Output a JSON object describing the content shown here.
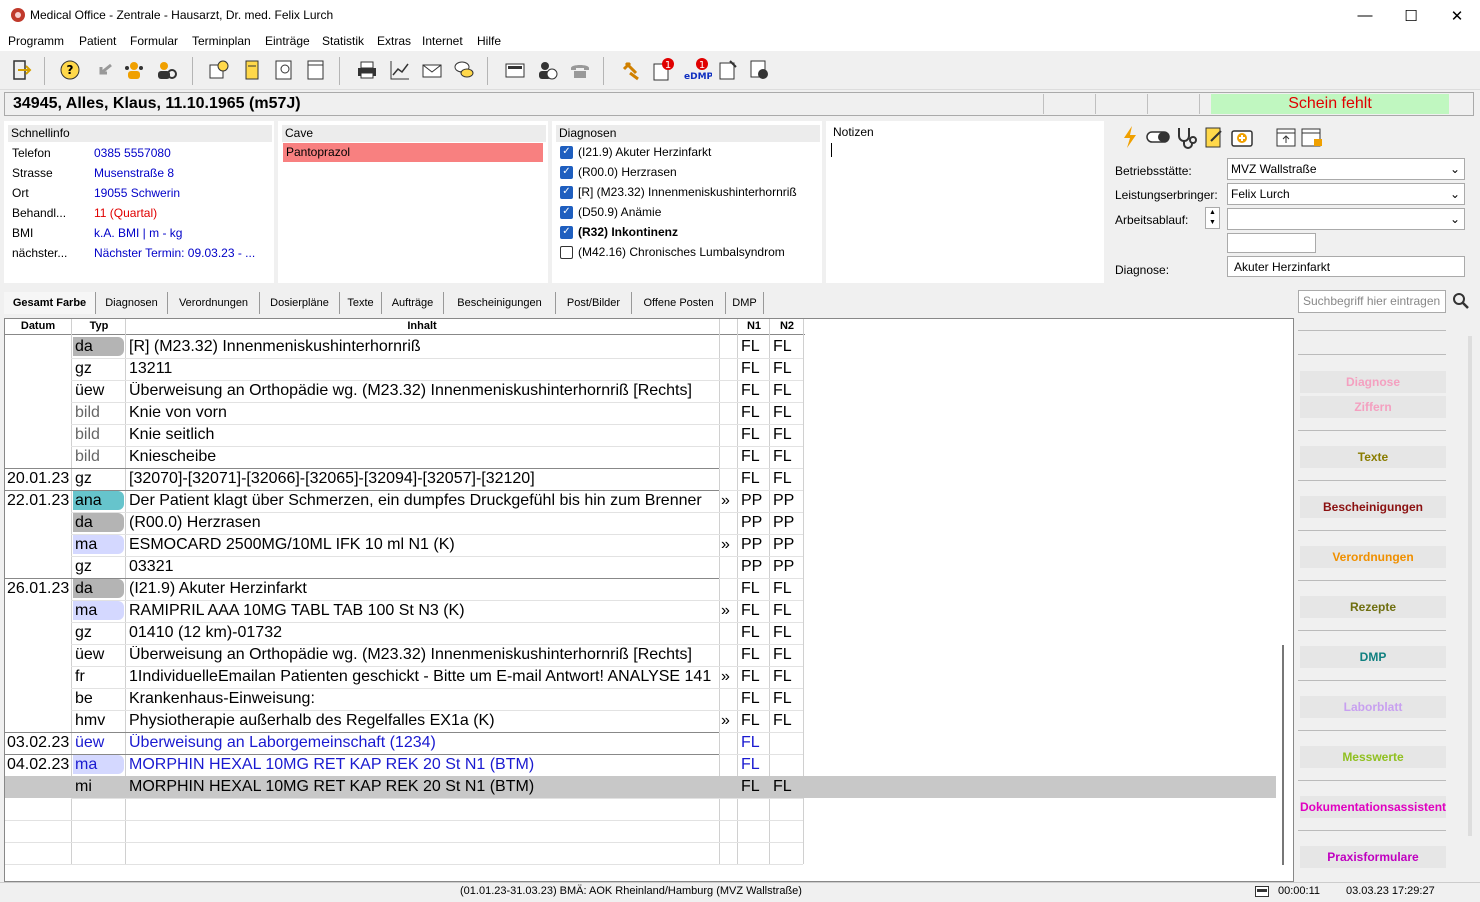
{
  "window": {
    "title": "Medical Office - Zentrale - Hausarzt, Dr. med. Felix Lurch"
  },
  "menu": [
    "Programm",
    "Patient",
    "Formular",
    "Terminplan",
    "Einträge",
    "Statistik",
    "Extras",
    "Internet",
    "Hilfe"
  ],
  "patient": {
    "header": "34945, Alles, Klaus, 11.10.1965 (m57J)",
    "schein_status": "Schein fehlt"
  },
  "schnellinfo": {
    "title": "Schnellinfo",
    "rows": [
      {
        "label": "Telefon",
        "value": "0385 5557080",
        "color": "#0000c8"
      },
      {
        "label": "Strasse",
        "value": "Musenstraße 8",
        "color": "#0000c8"
      },
      {
        "label": "Ort",
        "value": "19055 Schwerin",
        "color": "#0000c8"
      },
      {
        "label": "Behandl...",
        "value": "11 (Quartal)",
        "color": "#e00000"
      },
      {
        "label": "BMI",
        "value": "k.A. BMI |  m -  kg",
        "color": "#0000c8"
      },
      {
        "label": "nächster...",
        "value": "Nächster Termin: 09.03.23 - ...",
        "color": "#0000c8"
      }
    ]
  },
  "cave": {
    "title": "Cave",
    "items": [
      "Pantoprazol"
    ]
  },
  "diagnosen": {
    "title": "Diagnosen",
    "items": [
      {
        "text": "(I21.9) Akuter Herzinfarkt",
        "checked": true,
        "bold": false
      },
      {
        "text": "(R00.0) Herzrasen",
        "checked": true,
        "bold": false
      },
      {
        "text": "[R] (M23.32) Innenmeniskushinterhornriß",
        "checked": true,
        "bold": false
      },
      {
        "text": "(D50.9) Anämie",
        "checked": true,
        "bold": false
      },
      {
        "text": "(R32) Inkontinenz",
        "checked": true,
        "bold": true
      },
      {
        "text": "(M42.16) Chronisches Lumbalsyndrom",
        "checked": false,
        "bold": false
      }
    ]
  },
  "notizen": {
    "title": "Notizen",
    "text": ""
  },
  "form": {
    "betriebsstaette_label": "Betriebsstätte:",
    "betriebsstaette_value": "MVZ Wallstraße",
    "leistungserbringer_label": "Leistungserbringer:",
    "leistungserbringer_value": "Felix Lurch",
    "arbeitsablauf_label": "Arbeitsablauf:",
    "arbeitsablauf_value": "",
    "diagnose_label": "Diagnose:",
    "diagnose_value": "Akuter Herzinfarkt"
  },
  "tabs": [
    "Gesamt Farbe",
    "Diagnosen",
    "Verordnungen",
    "Dosierpläne",
    "Texte",
    "Aufträge",
    "Bescheinigungen",
    "Post/Bilder",
    "Offene Posten",
    "DMP"
  ],
  "active_tab": "Gesamt Farbe",
  "grid": {
    "headers": [
      "Datum",
      "Typ",
      "Inhalt",
      "N1",
      "N2"
    ],
    "rows": [
      {
        "date": "",
        "type": "da",
        "content": "[R] (M23.32) Innenmeniskushinterhornriß",
        "more": "",
        "n1": "FL",
        "n2": "FL",
        "chip": "#b4b4b4",
        "color": "#000"
      },
      {
        "date": "",
        "type": "gz",
        "content": "13211",
        "more": "",
        "n1": "FL",
        "n2": "FL",
        "chip": "",
        "color": "#000"
      },
      {
        "date": "",
        "type": "üew",
        "content": "Überweisung an Orthopädie wg. (M23.32) Innenmeniskushinterhornriß [Rechts]",
        "more": "",
        "n1": "FL",
        "n2": "FL",
        "chip": "",
        "color": "#000"
      },
      {
        "date": "",
        "type": "bild",
        "content": "Knie von vorn",
        "more": "",
        "n1": "FL",
        "n2": "FL",
        "chip": "",
        "color": "#000",
        "tcolor": "#666"
      },
      {
        "date": "",
        "type": "bild",
        "content": "Knie seitlich",
        "more": "",
        "n1": "FL",
        "n2": "FL",
        "chip": "",
        "color": "#000",
        "tcolor": "#666"
      },
      {
        "date": "",
        "type": "bild",
        "content": "Kniescheibe",
        "more": "",
        "n1": "FL",
        "n2": "FL",
        "chip": "",
        "color": "#000",
        "tcolor": "#666"
      },
      {
        "date": "20.01.23",
        "type": "gz",
        "content": "[32070]-[32071]-[32066]-[32065]-[32094]-[32057]-[32120]",
        "more": "",
        "n1": "FL",
        "n2": "FL",
        "chip": "",
        "color": "#000"
      },
      {
        "date": "22.01.23",
        "type": "ana",
        "content": "Der Patient klagt über Schmerzen, ein dumpfes Druckgefühl bis hin zum Brenner",
        "more": "»",
        "n1": "PP",
        "n2": "PP",
        "chip": "#66c4cc",
        "color": "#000"
      },
      {
        "date": "",
        "type": "da",
        "content": "(R00.0) Herzrasen",
        "more": "",
        "n1": "PP",
        "n2": "PP",
        "chip": "#b4b4b4",
        "color": "#000"
      },
      {
        "date": "",
        "type": "ma",
        "content": "ESMOCARD 2500MG/10ML IFK 10 ml N1 (K)",
        "more": "»",
        "n1": "PP",
        "n2": "PP",
        "chip": "#d4d8ff",
        "color": "#000"
      },
      {
        "date": "",
        "type": "gz",
        "content": "03321",
        "more": "",
        "n1": "PP",
        "n2": "PP",
        "chip": "",
        "color": "#000"
      },
      {
        "date": "26.01.23",
        "type": "da",
        "content": "(I21.9) Akuter Herzinfarkt",
        "more": "",
        "n1": "FL",
        "n2": "FL",
        "chip": "#b4b4b4",
        "color": "#000"
      },
      {
        "date": "",
        "type": "ma",
        "content": "RAMIPRIL AAA 10MG TABL TAB 100 St N3 (K)",
        "more": "»",
        "n1": "FL",
        "n2": "FL",
        "chip": "#d4d8ff",
        "color": "#000"
      },
      {
        "date": "",
        "type": "gz",
        "content": "01410 (12 km)-01732",
        "more": "",
        "n1": "FL",
        "n2": "FL",
        "chip": "",
        "color": "#000"
      },
      {
        "date": "",
        "type": "üew",
        "content": "Überweisung an Orthopädie wg. (M23.32) Innenmeniskushinterhornriß [Rechts]",
        "more": "",
        "n1": "FL",
        "n2": "FL",
        "chip": "",
        "color": "#000"
      },
      {
        "date": "",
        "type": "fr",
        "content": "1IndividuelleEmailan Patienten geschickt - Bitte um E-mail Antwort! ANALYSE 141",
        "more": "»",
        "n1": "FL",
        "n2": "FL",
        "chip": "",
        "color": "#000"
      },
      {
        "date": "",
        "type": "be",
        "content": "Krankenhaus-Einweisung:",
        "more": "",
        "n1": "FL",
        "n2": "FL",
        "chip": "",
        "color": "#000"
      },
      {
        "date": "",
        "type": "hmv",
        "content": "Physiotherapie außerhalb des Regelfalles EX1a (K)",
        "more": "»",
        "n1": "FL",
        "n2": "FL",
        "chip": "",
        "color": "#000"
      },
      {
        "date": "03.02.23",
        "type": "üew",
        "content": "Überweisung an Laborgemeinschaft (1234)",
        "more": "",
        "n1": "FL",
        "n2": "",
        "chip": "",
        "color": "#1a1ad0"
      },
      {
        "date": "04.02.23",
        "type": "ma",
        "content": "MORPHIN HEXAL 10MG RET KAP REK 20 St N1 (BTM)",
        "more": "",
        "n1": "FL",
        "n2": "",
        "chip": "#d4d8ff",
        "color": "#1a1ad0"
      },
      {
        "date": "",
        "type": "mi",
        "content": "MORPHIN HEXAL 10MG RET KAP REK 20 St N1 (BTM)",
        "more": "",
        "n1": "FL",
        "n2": "FL",
        "chip": "",
        "color": "#000",
        "selected": true
      }
    ]
  },
  "search": {
    "placeholder": "Suchbegriff hier eintragen"
  },
  "side_buttons": [
    {
      "label": "Diagnose",
      "color": "#f4a0c0"
    },
    {
      "label": "Ziffern",
      "color": "#f4a0c0"
    },
    {
      "label": "Texte",
      "color": "#8a7c00"
    },
    {
      "label": "Bescheinigungen",
      "color": "#8b1010"
    },
    {
      "label": "Verordnungen",
      "color": "#f09000"
    },
    {
      "label": "Rezepte",
      "color": "#6f6f10"
    },
    {
      "label": "DMP",
      "color": "#108080"
    },
    {
      "label": "Laborblatt",
      "color": "#c8a0f0"
    },
    {
      "label": "Messwerte",
      "color": "#90c020"
    },
    {
      "label": "Dokumentationsassistent",
      "color": "#e000c0"
    },
    {
      "label": "Praxisformulare",
      "color": "#c000c0"
    }
  ],
  "status": {
    "center": "(01.01.23-31.03.23) BMÄ: AOK Rheinland/Hamburg (MVZ Wallstraße)",
    "timer": "00:00:11",
    "datetime": "03.03.23 17:29:27"
  },
  "toolbar": {
    "badge1": "1",
    "badge2": "1",
    "edmp_label": "eDMP"
  }
}
